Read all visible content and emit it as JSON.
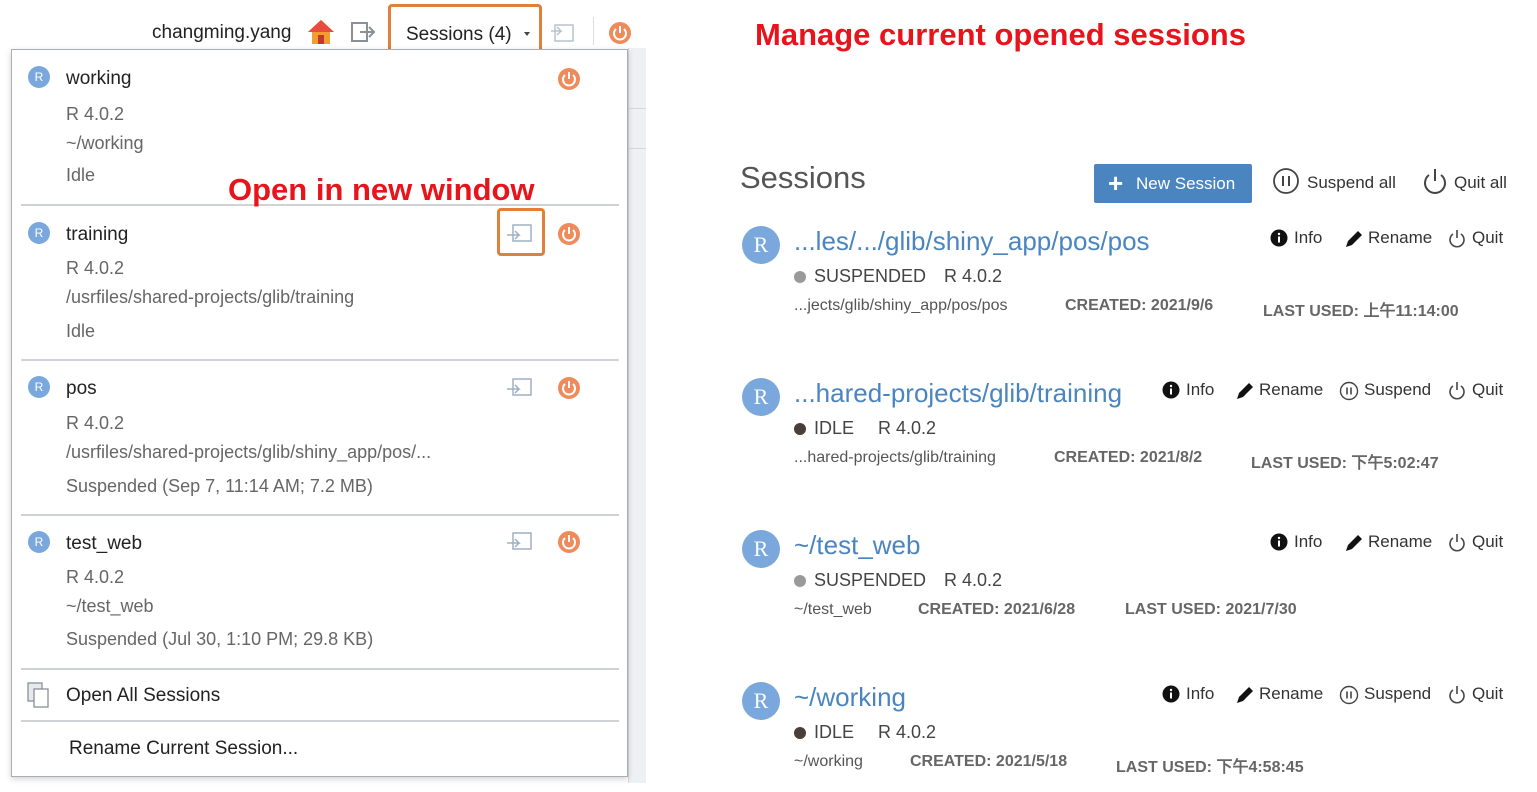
{
  "toolbar": {
    "username": "changming.yang",
    "sessions_label": "Sessions (4)"
  },
  "annotations": {
    "manage": "Manage current opened sessions",
    "open_new": "Open in new window"
  },
  "dropdown": {
    "items": [
      {
        "name": "working",
        "version": "R 4.0.2",
        "path": "~/working",
        "status": "Idle"
      },
      {
        "name": "training",
        "version": "R 4.0.2",
        "path": "/usrfiles/shared-projects/glib/training",
        "status": "Idle"
      },
      {
        "name": "pos",
        "version": "R 4.0.2",
        "path": "/usrfiles/shared-projects/glib/shiny_app/pos/...",
        "status": "Suspended (Sep 7, 11:14 AM; 7.2 MB)"
      },
      {
        "name": "test_web",
        "version": "R 4.0.2",
        "path": "~/test_web",
        "status": "Suspended (Jul 30, 1:10 PM; 29.8 KB)"
      }
    ],
    "open_all": "Open All Sessions",
    "rename_current": "Rename Current Session..."
  },
  "manager": {
    "title": "Sessions",
    "new_session": "New Session",
    "suspend_all": "Suspend all",
    "quit_all": "Quit all",
    "badge": "R",
    "labels": {
      "info": "Info",
      "rename": "Rename",
      "suspend": "Suspend",
      "quit": "Quit"
    },
    "sessions": [
      {
        "path": "...les/.../glib/shiny_app/pos/pos",
        "status": "SUSPENDED",
        "version": "R 4.0.2",
        "sub": "...jects/glib/shiny_app/pos/pos",
        "created": "CREATED: 2021/9/6",
        "last_used": "LAST USED: 上午11:14:00"
      },
      {
        "path": "...hared-projects/glib/training",
        "status": "IDLE",
        "version": "R 4.0.2",
        "sub": "...hared-projects/glib/training",
        "created": "CREATED: 2021/8/2",
        "last_used": "LAST USED: 下午5:02:47"
      },
      {
        "path": "~/test_web",
        "status": "SUSPENDED",
        "version": "R 4.0.2",
        "sub": "~/test_web",
        "created": "CREATED: 2021/6/28",
        "last_used": "LAST USED: 2021/7/30"
      },
      {
        "path": "~/working",
        "status": "IDLE",
        "version": "R 4.0.2",
        "sub": "~/working",
        "created": "CREATED: 2021/5/18",
        "last_used": "LAST USED: 下午4:58:45"
      }
    ]
  },
  "colors": {
    "accent": "#4b85c0",
    "annotation": "#e8141b",
    "highlight": "#e0803a",
    "power": "#ef8a5a",
    "suspended_dot": "#9a9a9a",
    "idle_dot": "#4a3f38"
  }
}
